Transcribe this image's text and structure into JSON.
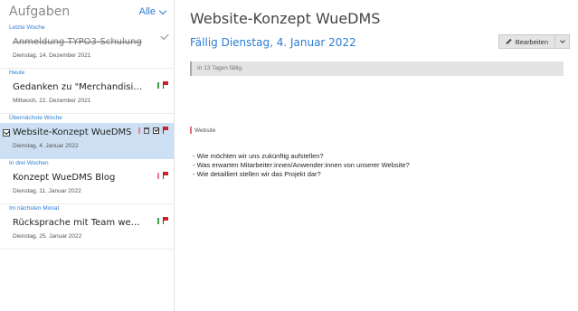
{
  "sidebar": {
    "title": "Aufgaben",
    "filter_label": "Alle",
    "groups": [
      {
        "label": "Letzte Woche",
        "tasks": [
          {
            "title": "Anmeldung TYPO3-Schulung",
            "date": "Dienstag, 14. Dezember 2021",
            "done": true
          }
        ]
      },
      {
        "label": "Heute",
        "tasks": [
          {
            "title": "Gedanken zu \"Merchandising\" mach...",
            "date": "Mittwoch, 22. Dezember 2021",
            "done": false
          }
        ]
      },
      {
        "label": "Übernächste Woche",
        "tasks": [
          {
            "title": "Website-Konzept WueDMS",
            "date": "Dienstag, 4. Januar 2022",
            "done": false,
            "selected": true
          }
        ]
      },
      {
        "label": "In drei Wochen",
        "tasks": [
          {
            "title": "Konzept WueDMS Blog",
            "date": "Dienstag, 11. Januar 2022",
            "done": false
          }
        ]
      },
      {
        "label": "Im nächsten Monat",
        "tasks": [
          {
            "title": "Rücksprache mit Team wegen Conte...",
            "date": "Dienstag, 25. Januar 2022",
            "done": false
          }
        ]
      }
    ]
  },
  "detail": {
    "title": "Website-Konzept WueDMS",
    "due": "Fällig Dienstag, 4. Januar 2022",
    "edit_label": "Bearbeiten",
    "info": "In 13 Tagen fällig.",
    "category": "Website",
    "notes": [
      "- Wie möchten wir uns zukünftig aufstellen?",
      "- Was erwarten Mitarbeiter:innen/Anwender:innen von unserer Website?",
      "- Wie detailliert stellen wir das Projekt dar?"
    ]
  },
  "colors": {
    "accent": "#2d7dd2",
    "selected_bg": "#cde0f3",
    "flag_red": "#d21f2d",
    "category_green": "#3aa14b",
    "category_red": "#e04a5a"
  }
}
